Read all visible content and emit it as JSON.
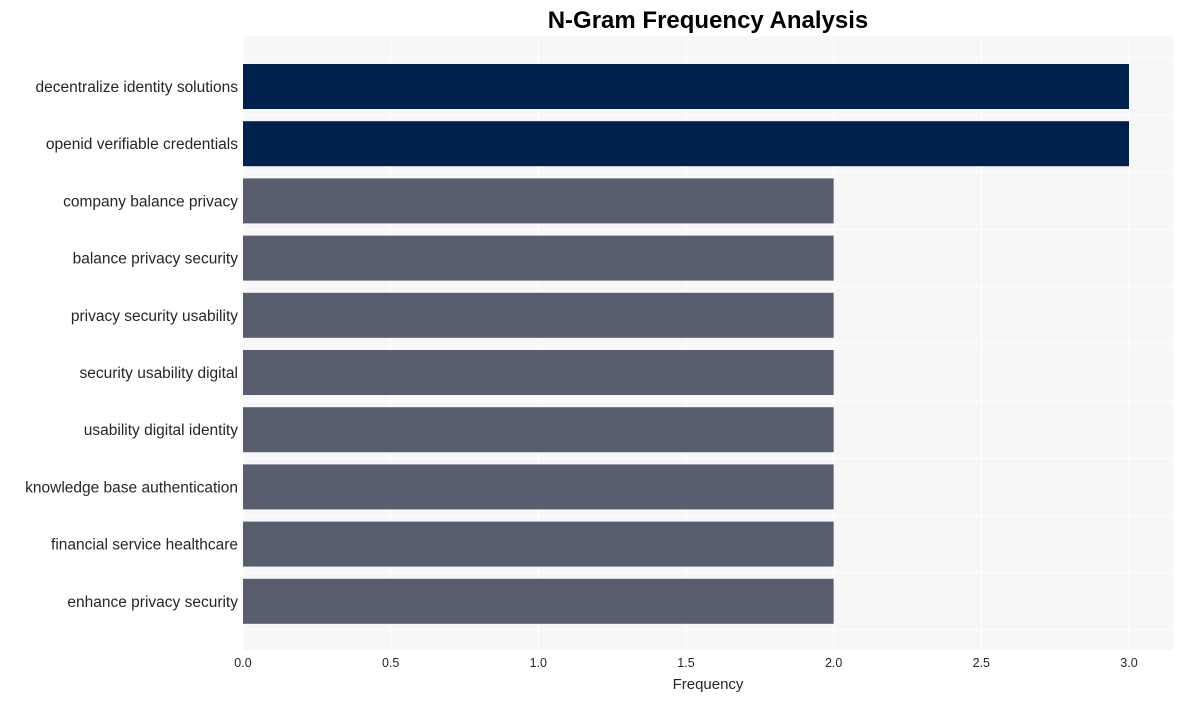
{
  "chart_data": {
    "type": "bar",
    "orientation": "horizontal",
    "title": "N-Gram Frequency Analysis",
    "xlabel": "Frequency",
    "ylabel": "",
    "xlim": [
      0,
      3.15
    ],
    "xticks": [
      0.0,
      0.5,
      1.0,
      1.5,
      2.0,
      2.5,
      3.0
    ],
    "xtick_labels": [
      "0.0",
      "0.5",
      "1.0",
      "1.5",
      "2.0",
      "2.5",
      "3.0"
    ],
    "grid": true,
    "categories": [
      "decentralize identity solutions",
      "openid verifiable credentials",
      "company balance privacy",
      "balance privacy security",
      "privacy security usability",
      "security usability digital",
      "usability digital identity",
      "knowledge base authentication",
      "financial service healthcare",
      "enhance privacy security"
    ],
    "values": [
      3,
      3,
      2,
      2,
      2,
      2,
      2,
      2,
      2,
      2
    ],
    "colors": {
      "highlight": "#00214e",
      "default": "#585e6d",
      "plot_background": "#f7f7f7",
      "grid": "#ffffff"
    }
  }
}
